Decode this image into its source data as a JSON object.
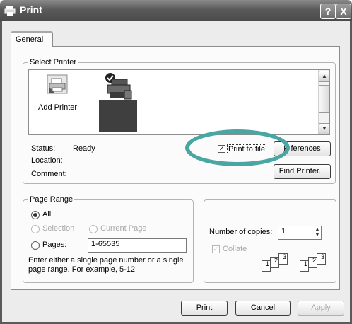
{
  "window": {
    "title": "Print",
    "help_label": "?",
    "close_label": "X"
  },
  "tabs": [
    {
      "label": "General"
    }
  ],
  "select_printer": {
    "group_label": "Select Printer",
    "printers": [
      {
        "name": "Add Printer",
        "icon": "add-printer-icon"
      },
      {
        "name": "",
        "icon": "network-printer-icon"
      }
    ]
  },
  "status": {
    "status_label": "Status:",
    "status_value": "Ready",
    "location_label": "Location:",
    "location_value": "",
    "comment_label": "Comment:",
    "comment_value": ""
  },
  "print_to_file": {
    "label": "Print to file",
    "checked": true
  },
  "buttons": {
    "preferences": "Preferences",
    "preferences_visible": "P    ferences",
    "find_printer": "Find Printer...",
    "print": "Print",
    "cancel": "Cancel",
    "apply": "Apply"
  },
  "page_range": {
    "group_label": "Page Range",
    "all": "All",
    "selection": "Selection",
    "current_page": "Current Page",
    "pages": "Pages:",
    "pages_value": "1-65535",
    "hint_line1": "Enter either a single page number or a single",
    "hint_line2": "page range.  For example, 5-12",
    "selected": "all"
  },
  "copies": {
    "label": "Number of copies:",
    "value": "1",
    "collate_label": "Collate",
    "collate_checked": true,
    "collate_enabled": false,
    "page_numbers": [
      "1",
      "2",
      "3"
    ]
  },
  "annotation": {
    "color": "#4aa6a2"
  }
}
